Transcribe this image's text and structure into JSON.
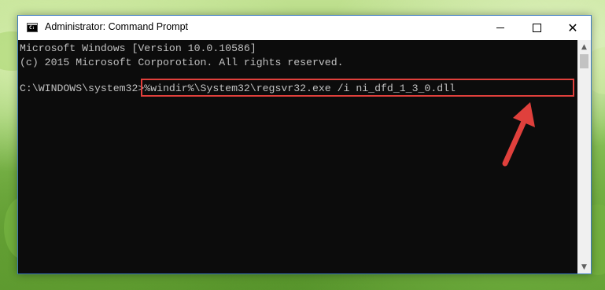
{
  "window": {
    "title": "Administrator: Command Prompt",
    "controls": {
      "minimize": "minimize",
      "maximize": "maximize",
      "close": "close"
    }
  },
  "console": {
    "lines": [
      "Microsoft Windows [Version 10.0.10586]",
      "(c) 2015 Microsoft Corporotion. All rights reserved."
    ],
    "prompt": "C:\\WINDOWS\\system32>",
    "command": "%windir%\\System32\\regsvr32.exe /i ni_dfd_1_3_0.dll"
  },
  "colors": {
    "highlight_border": "#e0403c",
    "arrow": "#e0403c",
    "console_bg": "#0c0c0c",
    "console_text": "#c0c0c0"
  },
  "icons": {
    "app": "cmd-icon",
    "annotation": "red-arrow-icon"
  }
}
